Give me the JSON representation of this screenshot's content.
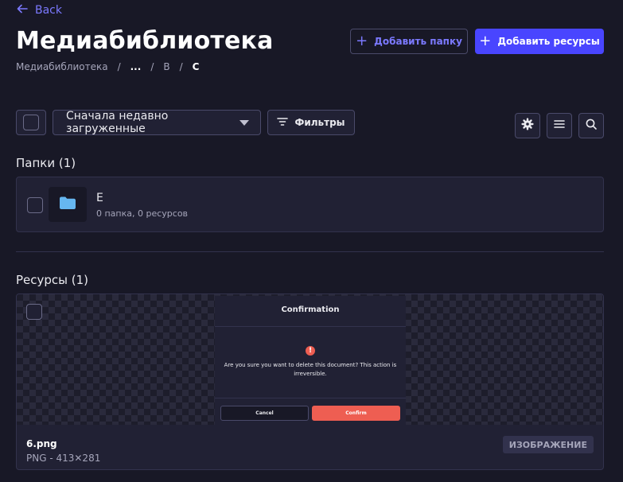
{
  "header": {
    "back_label": "Back",
    "title": "Медиабиблиотека",
    "add_folder_label": "Добавить папку",
    "add_assets_label": "Добавить ресурсы"
  },
  "breadcrumb": {
    "root": "Медиабиблиотека",
    "ellipsis": "...",
    "level_b": "B",
    "current": "C",
    "separator": "/"
  },
  "toolbar": {
    "sort_value": "Сначала недавно загруженные",
    "filters_label": "Фильтры",
    "icons": [
      "gear-icon",
      "list-view-icon",
      "search-icon"
    ]
  },
  "folders": {
    "heading": "Папки (1)",
    "items": [
      {
        "name": "E",
        "meta": "0 папка, 0 ресурсов",
        "icon": "folder-icon"
      }
    ]
  },
  "assets": {
    "heading": "Ресурсы (1)",
    "items": [
      {
        "name": "6.png",
        "meta": "PNG - 413✕281",
        "badge": "ИЗОБРАЖЕНИЕ",
        "preview": {
          "title": "Confirmation",
          "message": "Are you sure you want to delete this document? This action is irreversible.",
          "cancel": "Cancel",
          "confirm": "Confirm"
        }
      }
    ]
  },
  "colors": {
    "background": "#181826",
    "surface": "#212134",
    "border": "#4a4a6a",
    "primary": "#4945ff",
    "primary_text": "#7b79ff",
    "danger": "#ee5e52",
    "folder_icon": "#66b7f1"
  }
}
